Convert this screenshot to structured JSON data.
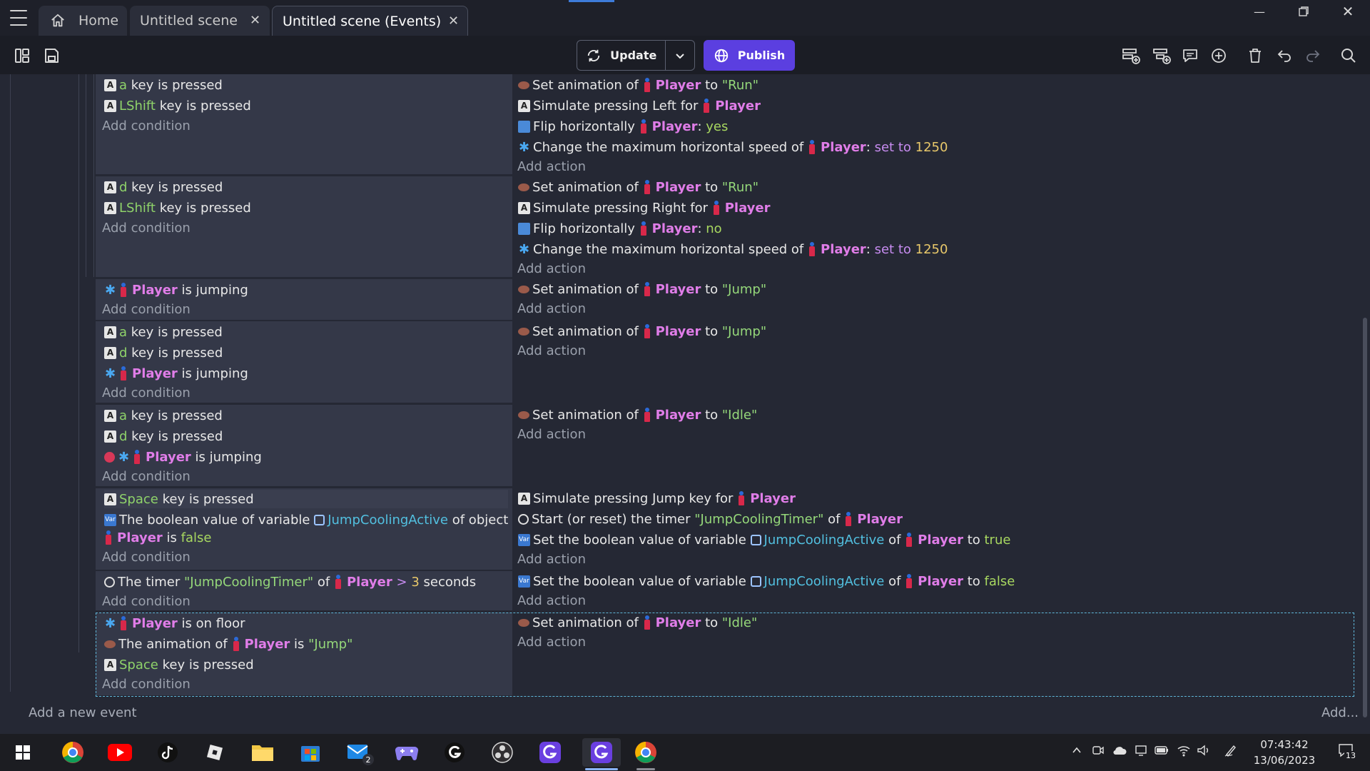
{
  "tabs": [
    {
      "label": "Home"
    },
    {
      "label": "Untitled scene"
    },
    {
      "label": "Untitled scene (Events)"
    }
  ],
  "toolbar": {
    "update_label": "Update",
    "publish_label": "Publish"
  },
  "colors": {
    "publish_bg": "#5b3fe0",
    "object": "#e07de8",
    "key": "#8fd36a",
    "variable": "#52c0e0",
    "number": "#e8c86a"
  },
  "text": {
    "add_condition": "Add condition",
    "add_action": "Add action",
    "key_is_pressed": "key is pressed",
    "player": "Player",
    "is_jumping": "is jumping",
    "is_on_floor": "is on floor",
    "set_animation_of": "Set animation of",
    "to": "to",
    "simulate_pressing": "Simulate pressing",
    "for": "for",
    "flip_horizontally": "Flip horizontally",
    "colon": ":",
    "change_max_speed": "Change the maximum horizontal speed of",
    "set_to": "set to",
    "of": "of",
    "of_object": "of object",
    "is": "is",
    "yes": "yes",
    "no": "no",
    "true": "true",
    "false": "false",
    "seconds": "seconds",
    "gt": ">"
  },
  "values": {
    "key_a": "a",
    "key_d": "d",
    "key_lshift": "LShift",
    "key_space": "Space",
    "anim_run": "\"Run\"",
    "anim_jump": "\"Jump\"",
    "anim_idle": "\"Idle\"",
    "left": "Left",
    "right": "Right",
    "speed": "1250",
    "var_name": "JumpCoolingActive",
    "timer_name": "\"JumpCoolingTimer\"",
    "timer_seconds": "3",
    "boolean_condition": "The boolean value of variable",
    "simulate_jump": "Simulate pressing Jump key for",
    "start_timer": "Start (or reset) the timer",
    "set_boolean": "Set the boolean value of variable",
    "the_timer": "The timer",
    "the_animation_of": "The animation of"
  },
  "footer": {
    "add_new_event": "Add a new event",
    "add_more": "Add..."
  },
  "taskbar": {
    "apps": [
      "windows-start",
      "chrome",
      "youtube",
      "tiktok",
      "roblox",
      "file-explorer",
      "microsoft-store",
      "mail",
      "game-controller",
      "logitech-g",
      "obs",
      "gdevelop",
      "gdevelop-active",
      "chrome-active"
    ],
    "mail_badge": "2",
    "time": "07:43:42",
    "date": "13/06/2023",
    "notification_count": "13"
  }
}
